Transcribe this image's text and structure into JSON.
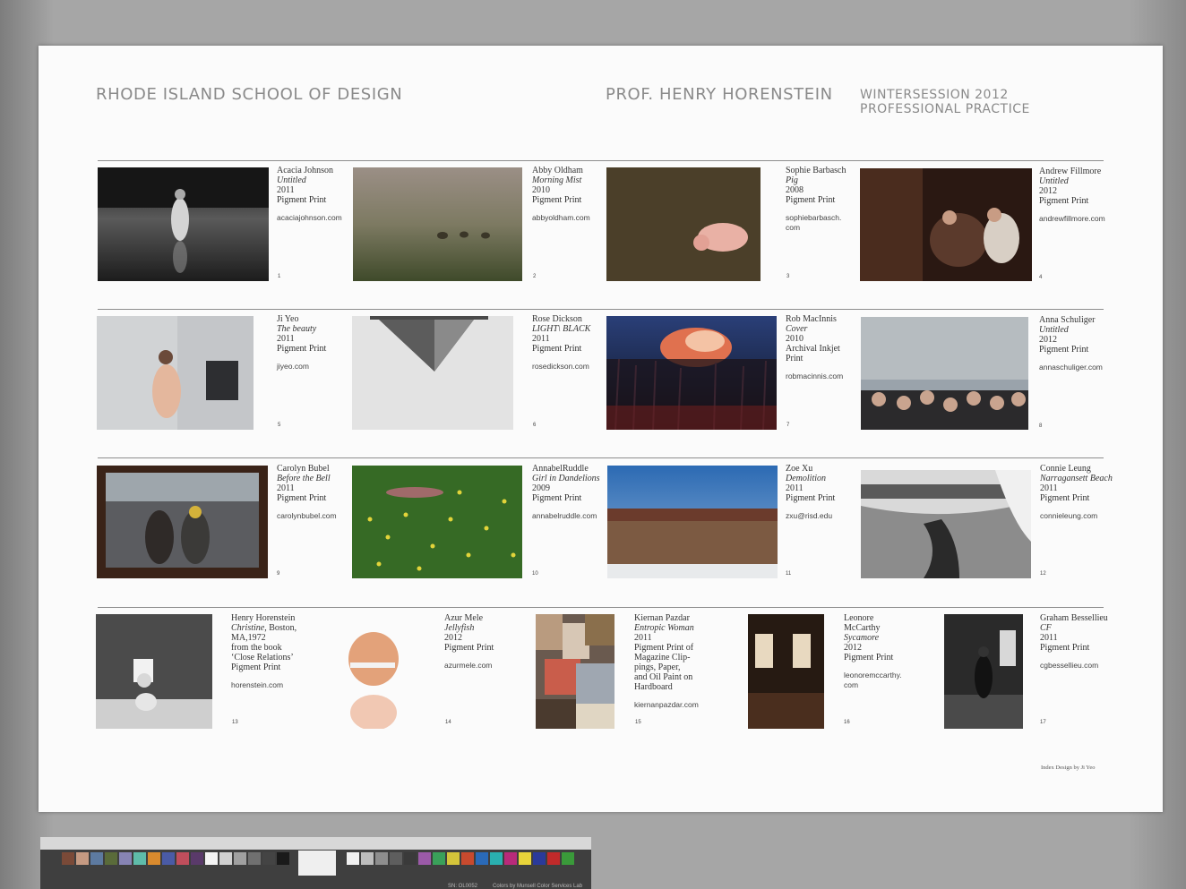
{
  "header": {
    "school": "RHODE ISLAND SCHOOL OF DESIGN",
    "professor": "PROF. HENRY HORENSTEIN",
    "course_line1": "WINTERSESSION 2012",
    "course_line2": "PROFESSIONAL PRACTICE"
  },
  "works": [
    {
      "num": "1",
      "name": "Acacia Johnson",
      "title": "Untitled",
      "year": "2011",
      "medium": "Pigment Print",
      "url": "acaciajohnson.com"
    },
    {
      "num": "2",
      "name": "Abby Oldham",
      "title": "Morning Mist",
      "year": "2010",
      "medium": "Pigment Print",
      "url": "abbyoldham.com"
    },
    {
      "num": "3",
      "name": "Sophie Barbasch",
      "title": "Pig",
      "year": "2008",
      "medium": "Pigment Print",
      "url": "sophiebarbasch.\ncom"
    },
    {
      "num": "4",
      "name": "Andrew Fillmore",
      "title": "Untitled",
      "year": "2012",
      "medium": "Pigment Print",
      "url": "andrewfillmore.com"
    },
    {
      "num": "5",
      "name": "Ji Yeo",
      "title": "The beauty",
      "year": "2011",
      "medium": "Pigment Print",
      "url": "jiyeo.com"
    },
    {
      "num": "6",
      "name": "Rose Dickson",
      "title": "LIGHT\\ BLACK",
      "year": "2011",
      "medium": "Pigment Print",
      "url": "rosedickson.com"
    },
    {
      "num": "7",
      "name": "Rob MacInnis",
      "title": "Cover",
      "year": "2010",
      "medium": "Archival Inkjet\nPrint",
      "url": "robmacinnis.com"
    },
    {
      "num": "8",
      "name": "Anna Schuliger",
      "title": "Untitled",
      "year": "2012",
      "medium": "Pigment Print",
      "url": "annaschuliger.com"
    },
    {
      "num": "9",
      "name": "Carolyn Bubel",
      "title": "Before the Bell",
      "year": "2011",
      "medium": "Pigment Print",
      "url": "carolynbubel.com"
    },
    {
      "num": "10",
      "name": "AnnabelRuddle",
      "title": "Girl in Dandelions",
      "year": "2009",
      "medium": "Pigment Print",
      "url": "annabelruddle.com"
    },
    {
      "num": "11",
      "name": "Zoe Xu",
      "title": "Demolition",
      "year": "2011",
      "medium": "Pigment Print",
      "url": "zxu@risd.edu"
    },
    {
      "num": "12",
      "name": "Connie Leung",
      "title": "Narragansett Beach",
      "year": "2011",
      "medium": "Pigment Print",
      "url": "connieleung.com"
    },
    {
      "num": "13",
      "name": "Henry Horenstein",
      "title": "Christine",
      "title_suffix": ", Boston,\nMA,1972\nfrom the book\n‘Close Relations’",
      "year": "",
      "medium": "Pigment Print",
      "url": "horenstein.com"
    },
    {
      "num": "14",
      "name": "Azur Mele",
      "title": "Jellyfish",
      "year": "2012",
      "medium": "Pigment Print",
      "url": "azurmele.com"
    },
    {
      "num": "15",
      "name": "Kiernan Pazdar",
      "title": "Entropic Woman",
      "year": "2011",
      "medium": "Pigment Print of\nMagazine Clip-\npings, Paper,\nand Oil Paint on\nHardboard",
      "url": "kiernanpazdar.com"
    },
    {
      "num": "16",
      "name": "Leonore\nMcCarthy",
      "title": "Sycamore",
      "year": "2012",
      "medium": "Pigment Print",
      "url": "leonoremccarthy.\ncom"
    },
    {
      "num": "17",
      "name": "Graham Bessellieu",
      "title": "CF",
      "year": "2011",
      "medium": "Pigment Print",
      "url": "cgbessellieu.com"
    }
  ],
  "credit": "Index Design by Ji Yeo",
  "color_checker": {
    "label": "SN: OL0052",
    "note": "Colors by Munsell Color Services Lab"
  }
}
